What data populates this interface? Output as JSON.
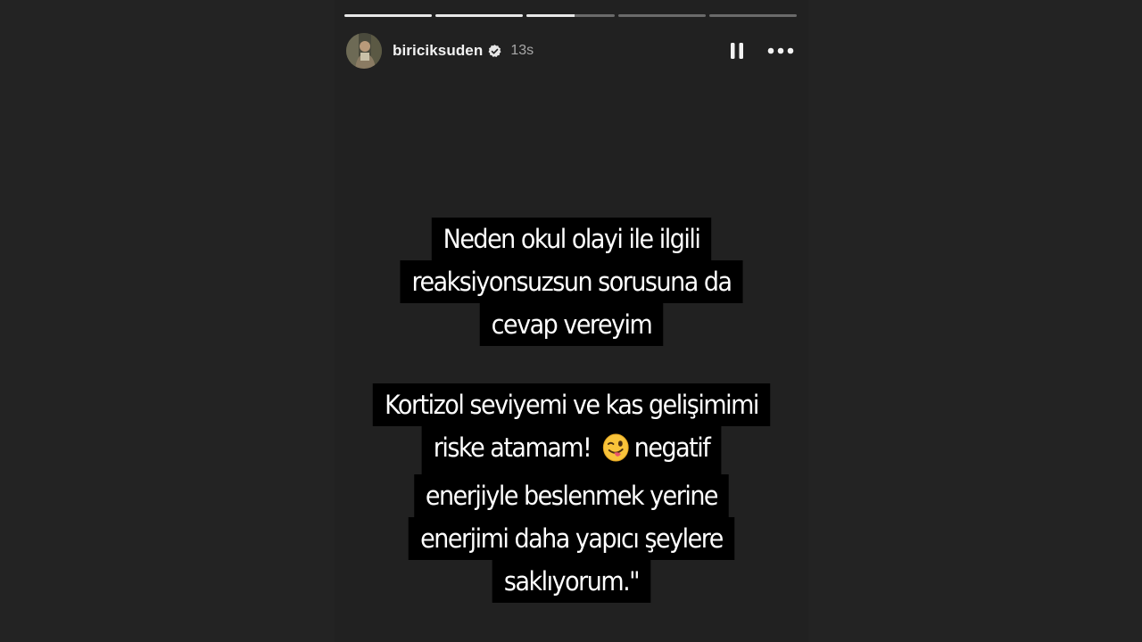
{
  "story": {
    "username": "biriciksuden",
    "timestamp": "13s",
    "verified": true,
    "progress": {
      "segments": 5,
      "completed": 2,
      "current_index": 2,
      "current_fraction": 0.55
    },
    "icons": {
      "avatar": "avatar-photo",
      "verified": "verified-badge-icon",
      "pause": "pause-icon",
      "more": "more-options-icon",
      "emoji": "winking-face-with-tongue-emoji"
    },
    "colors": {
      "background": "#212121",
      "text_box": "#000000",
      "text": "#ffffff"
    }
  },
  "caption1": {
    "lines": [
      "Neden okul olayi ile ilgili",
      "reaksiyonsuzsun sorusuna da",
      "cevap vereyim"
    ]
  },
  "caption2": {
    "line1": "Kortizol seviyemi ve kas gelişimimi",
    "line2_before": "riske atamam!",
    "line2_after": "negatif",
    "line3": "enerjiyle beslenmek yerine",
    "line4": "enerjimi daha yapıcı şeylere",
    "line5": "saklıyorum.\""
  }
}
